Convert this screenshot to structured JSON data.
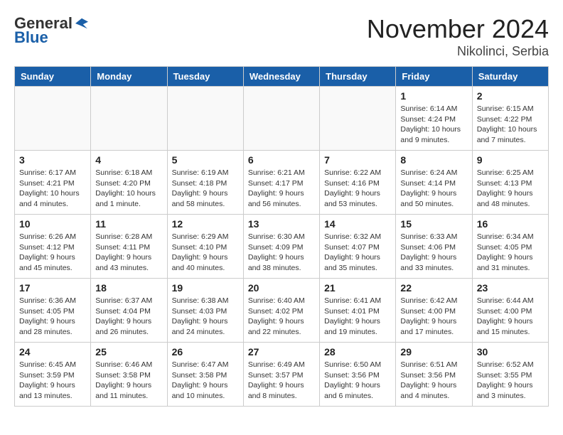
{
  "header": {
    "logo_general": "General",
    "logo_blue": "Blue",
    "month_title": "November 2024",
    "location": "Nikolinci, Serbia"
  },
  "days_of_week": [
    "Sunday",
    "Monday",
    "Tuesday",
    "Wednesday",
    "Thursday",
    "Friday",
    "Saturday"
  ],
  "weeks": [
    [
      {
        "day": "",
        "info": ""
      },
      {
        "day": "",
        "info": ""
      },
      {
        "day": "",
        "info": ""
      },
      {
        "day": "",
        "info": ""
      },
      {
        "day": "",
        "info": ""
      },
      {
        "day": "1",
        "info": "Sunrise: 6:14 AM\nSunset: 4:24 PM\nDaylight: 10 hours and 9 minutes."
      },
      {
        "day": "2",
        "info": "Sunrise: 6:15 AM\nSunset: 4:22 PM\nDaylight: 10 hours and 7 minutes."
      }
    ],
    [
      {
        "day": "3",
        "info": "Sunrise: 6:17 AM\nSunset: 4:21 PM\nDaylight: 10 hours and 4 minutes."
      },
      {
        "day": "4",
        "info": "Sunrise: 6:18 AM\nSunset: 4:20 PM\nDaylight: 10 hours and 1 minute."
      },
      {
        "day": "5",
        "info": "Sunrise: 6:19 AM\nSunset: 4:18 PM\nDaylight: 9 hours and 58 minutes."
      },
      {
        "day": "6",
        "info": "Sunrise: 6:21 AM\nSunset: 4:17 PM\nDaylight: 9 hours and 56 minutes."
      },
      {
        "day": "7",
        "info": "Sunrise: 6:22 AM\nSunset: 4:16 PM\nDaylight: 9 hours and 53 minutes."
      },
      {
        "day": "8",
        "info": "Sunrise: 6:24 AM\nSunset: 4:14 PM\nDaylight: 9 hours and 50 minutes."
      },
      {
        "day": "9",
        "info": "Sunrise: 6:25 AM\nSunset: 4:13 PM\nDaylight: 9 hours and 48 minutes."
      }
    ],
    [
      {
        "day": "10",
        "info": "Sunrise: 6:26 AM\nSunset: 4:12 PM\nDaylight: 9 hours and 45 minutes."
      },
      {
        "day": "11",
        "info": "Sunrise: 6:28 AM\nSunset: 4:11 PM\nDaylight: 9 hours and 43 minutes."
      },
      {
        "day": "12",
        "info": "Sunrise: 6:29 AM\nSunset: 4:10 PM\nDaylight: 9 hours and 40 minutes."
      },
      {
        "day": "13",
        "info": "Sunrise: 6:30 AM\nSunset: 4:09 PM\nDaylight: 9 hours and 38 minutes."
      },
      {
        "day": "14",
        "info": "Sunrise: 6:32 AM\nSunset: 4:07 PM\nDaylight: 9 hours and 35 minutes."
      },
      {
        "day": "15",
        "info": "Sunrise: 6:33 AM\nSunset: 4:06 PM\nDaylight: 9 hours and 33 minutes."
      },
      {
        "day": "16",
        "info": "Sunrise: 6:34 AM\nSunset: 4:05 PM\nDaylight: 9 hours and 31 minutes."
      }
    ],
    [
      {
        "day": "17",
        "info": "Sunrise: 6:36 AM\nSunset: 4:05 PM\nDaylight: 9 hours and 28 minutes."
      },
      {
        "day": "18",
        "info": "Sunrise: 6:37 AM\nSunset: 4:04 PM\nDaylight: 9 hours and 26 minutes."
      },
      {
        "day": "19",
        "info": "Sunrise: 6:38 AM\nSunset: 4:03 PM\nDaylight: 9 hours and 24 minutes."
      },
      {
        "day": "20",
        "info": "Sunrise: 6:40 AM\nSunset: 4:02 PM\nDaylight: 9 hours and 22 minutes."
      },
      {
        "day": "21",
        "info": "Sunrise: 6:41 AM\nSunset: 4:01 PM\nDaylight: 9 hours and 19 minutes."
      },
      {
        "day": "22",
        "info": "Sunrise: 6:42 AM\nSunset: 4:00 PM\nDaylight: 9 hours and 17 minutes."
      },
      {
        "day": "23",
        "info": "Sunrise: 6:44 AM\nSunset: 4:00 PM\nDaylight: 9 hours and 15 minutes."
      }
    ],
    [
      {
        "day": "24",
        "info": "Sunrise: 6:45 AM\nSunset: 3:59 PM\nDaylight: 9 hours and 13 minutes."
      },
      {
        "day": "25",
        "info": "Sunrise: 6:46 AM\nSunset: 3:58 PM\nDaylight: 9 hours and 11 minutes."
      },
      {
        "day": "26",
        "info": "Sunrise: 6:47 AM\nSunset: 3:58 PM\nDaylight: 9 hours and 10 minutes."
      },
      {
        "day": "27",
        "info": "Sunrise: 6:49 AM\nSunset: 3:57 PM\nDaylight: 9 hours and 8 minutes."
      },
      {
        "day": "28",
        "info": "Sunrise: 6:50 AM\nSunset: 3:56 PM\nDaylight: 9 hours and 6 minutes."
      },
      {
        "day": "29",
        "info": "Sunrise: 6:51 AM\nSunset: 3:56 PM\nDaylight: 9 hours and 4 minutes."
      },
      {
        "day": "30",
        "info": "Sunrise: 6:52 AM\nSunset: 3:55 PM\nDaylight: 9 hours and 3 minutes."
      }
    ]
  ]
}
